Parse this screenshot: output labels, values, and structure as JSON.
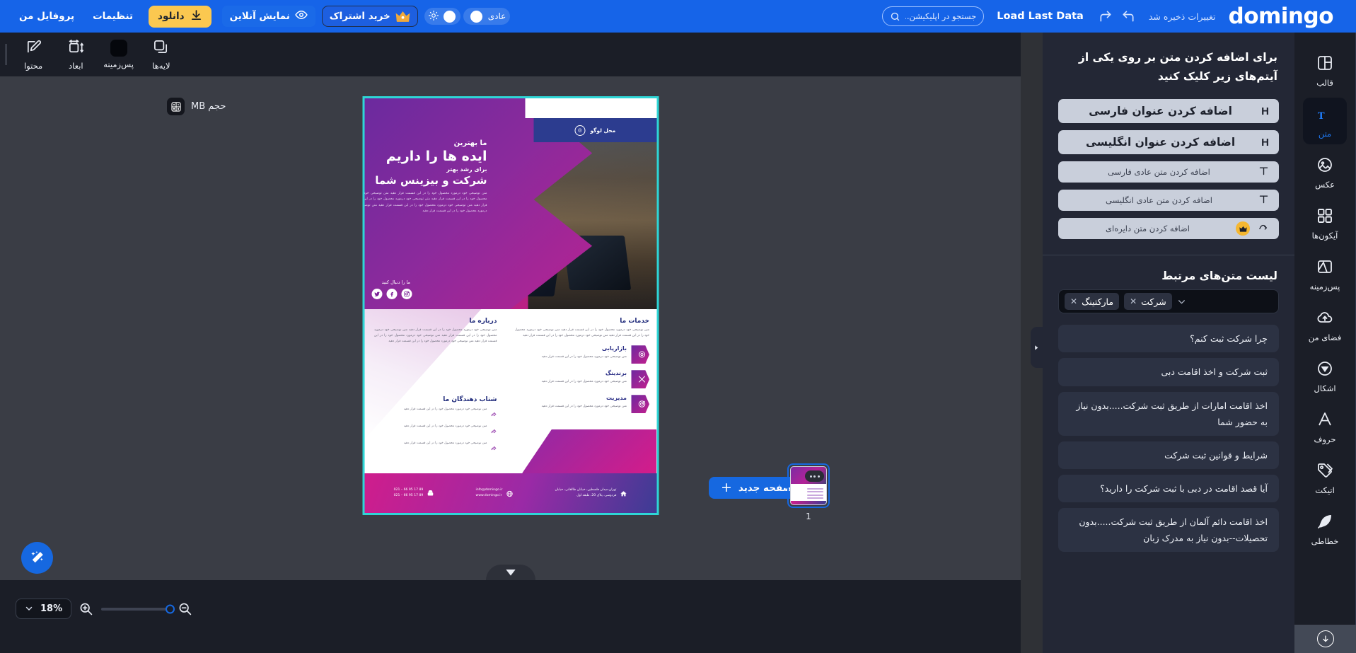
{
  "topbar": {
    "logo": "domingo",
    "saved_text": "تغییرات ذخیره شد",
    "undo_icon": "undo-icon",
    "redo_icon": "redo-icon",
    "load_last_data": "Load Last Data",
    "search_placeholder": "جستجو در اپلیکیشن...",
    "search_value": "",
    "search_icon": "search-icon",
    "theme_pill_label": "عادی",
    "sun_icon": "sun-icon",
    "subscribe_label": "خرید اشتراک",
    "crown_icon": "crown-icon",
    "online_preview_label": "نمایش آنلاین",
    "eye_icon": "eye-icon",
    "download_label": "دانلود",
    "download_icon": "download-icon",
    "settings_label": "تنظیمات",
    "profile_label": "پروفایل من"
  },
  "left_tools": [
    {
      "label": "لایه‌ها",
      "icon": "layers-icon"
    },
    {
      "label": "پس‌زمینه",
      "icon": "background-swatch-icon"
    },
    {
      "label": "ابعاد",
      "icon": "dimensions-icon"
    },
    {
      "label": "محتوا",
      "icon": "edit-pencil-icon"
    }
  ],
  "canvas": {
    "size_badge_label": "حجم MB",
    "size_badge_icon": "calculator-icon",
    "magic_icon": "magic-wand-icon",
    "chevron_icon": "chevron-down-icon"
  },
  "poster": {
    "logo_placeholder": "محل لوگو",
    "hero_line1": "ما بهترین",
    "hero_line2": "ایده ها را داریم",
    "hero_line3": "برای رشد بهتر",
    "hero_line4": "شرکت و بیزینس شما",
    "hero_paragraph": "متن توضیحی خود درمورد محصول خود را در این قسمت قرار دهید متن توضیحی خود درمورد محصول خود را در این قسمت قرار دهید متن توضیحی خود درمورد محصول خود را در این قسمت قرار دهید متن توضیحی خود درمورد محصول خود را در این قسمت قرار دهید متن توضیحی خود درمورد محصول خود را در این قسمت قرار دهید",
    "follow_label": "ما را دنبال کنید",
    "social_icons": [
      "instagram-icon",
      "facebook-icon",
      "twitter-icon"
    ],
    "about_heading": "درباره ما",
    "about_paragraph": "متن توضیحی خود درمورد محصول خود را در این قسمت قرار دهید متن توضیحی خود درمورد محصول خود را در این قسمت قرار دهید متن توضیحی خود درمورد محصول خود را در این قسمت قرار دهید متن توضیحی خود درمورد محصول خود را در این قسمت قرار دهید",
    "services_heading": "خدمات ما",
    "services_paragraph": "متن توضیحی خود درمورد محصول خود را در این قسمت قرار دهید متن توضیحی خود درمورد محصول خود را در این قسمت قرار دهید متن توضیحی خود درمورد محصول خود را در این قسمت قرار دهید",
    "services": [
      {
        "title": "بازاریابی",
        "desc": "متن توضیحی خود درمورد محصول خود را در این قسمت قرار دهید",
        "icon": "gear-target-icon"
      },
      {
        "title": "برندینگ",
        "desc": "متن توضیحی خود درمورد محصول خود را در این قسمت قرار دهید",
        "icon": "tools-icon"
      },
      {
        "title": "مدیریت",
        "desc": "متن توضیحی خود درمورد محصول خود را در این قسمت قرار دهید",
        "icon": "target-icon"
      }
    ],
    "accel_heading": "شتاب دهندگان ما",
    "accel_items": [
      "متن توضیحی خود درمورد محصول خود را در این قسمت قرار دهید",
      "متن توضیحی خود درمورد محصول خود را در این قسمت قرار دهید",
      "متن توضیحی خود درمورد محصول خود را در این قسمت قرار دهید"
    ],
    "footer_phone": "021 – 66 95 17 89\n021 – 66 95 17 89",
    "footer_email": "info@domingo.ir\nwww.domingo.ir",
    "footer_address": "تهران،میدان فلسطین، خیابان طالقانی، خیابان\nفردوسی، پلاک 20، طبقه اول"
  },
  "bottombar": {
    "zoom_value": "18%",
    "zoom_caret_icon": "chevron-down-icon",
    "zoom_in_icon": "zoom-in-icon",
    "zoom_out_icon": "zoom-out-icon",
    "new_page_label": "صفحه جدید",
    "new_page_icon": "plus-icon",
    "page_number": "1"
  },
  "right_panel": {
    "title": "برای اضافه کردن متن بر روی یکی از آیتم‌های زیر کلیک کنید",
    "add_items": [
      {
        "label": "اضافه کردن عنوان فارسی",
        "icon": "heading-icon",
        "size": "big",
        "premium": false
      },
      {
        "label": "اضافه کردن عنوان انگلیسی",
        "icon": "heading-icon",
        "size": "big",
        "premium": false
      },
      {
        "label": "اضافه کردن متن عادی فارسی",
        "icon": "text-icon",
        "size": "small",
        "premium": false
      },
      {
        "label": "اضافه کردن متن عادی انگلیسی",
        "icon": "text-icon",
        "size": "small",
        "premium": false
      },
      {
        "label": "اضافه کردن متن دایره‌ای",
        "icon": "curved-text-icon",
        "size": "small",
        "premium": true
      }
    ],
    "related_title": "لیست متن‌های مرتبط",
    "tags": [
      "شرکت",
      "مارکتینگ"
    ],
    "tag_remove_icon": "close-icon",
    "dropdown_caret_icon": "chevron-down-icon",
    "related_items": [
      "چرا شرکت ثبت کنم؟",
      "ثبت شرکت و اخذ اقامت دبی",
      "اخذ اقامت امارات از طریق ثبت شرکت.....بدون نیاز به حضور شما",
      "شرایط و قوانین ثبت شرکت",
      "آیا قصد اقامت در دبی با ثبت شرکت را دارید؟",
      "اخذ اقامت دائم آلمان از طریق ثبت شرکت.....بدون تحصیلات--بدون نیاز به مدرک زبان"
    ],
    "collapse_icon": "chevron-right-icon"
  },
  "right_nav": [
    {
      "label": "قالب",
      "icon": "template-icon",
      "active": false
    },
    {
      "label": "متن",
      "icon": "text-tool-icon",
      "active": true
    },
    {
      "label": "عکس",
      "icon": "image-icon",
      "active": false
    },
    {
      "label": "آیکون‌ها",
      "icon": "grid-icon",
      "active": false
    },
    {
      "label": "پس‌زمینه",
      "icon": "background-icon",
      "active": false
    },
    {
      "label": "فضای من",
      "icon": "cloud-upload-icon",
      "active": false
    },
    {
      "label": "اشکال",
      "icon": "shapes-icon",
      "active": false
    },
    {
      "label": "حروف",
      "icon": "letters-icon",
      "active": false
    },
    {
      "label": "اتیکت",
      "icon": "tag-icon",
      "active": false
    },
    {
      "label": "خطاطی",
      "icon": "feather-icon",
      "active": false
    }
  ],
  "right_nav_scroll_icon": "scroll-down-icon",
  "colors": {
    "brand_blue": "#1664e8",
    "accent_yellow": "#fbc850",
    "panel_dark": "#232735",
    "nav_dark": "#1b1e27",
    "canvas_bg": "#3a3d45",
    "poster_border": "#2ed6d6"
  }
}
